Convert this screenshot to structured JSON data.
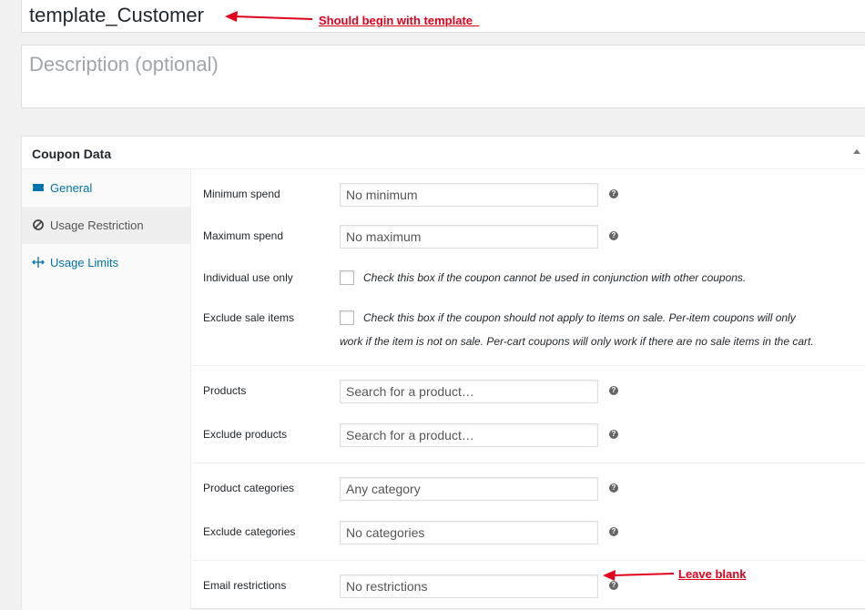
{
  "post": {
    "title": "template_Customer",
    "description_placeholder": "Description (optional)"
  },
  "annotations": {
    "title_note": "Should begin with template_",
    "email_note": "Leave blank"
  },
  "coupon_data": {
    "title": "Coupon Data",
    "tabs": [
      {
        "label": "General",
        "icon": "ticket-icon"
      },
      {
        "label": "Usage Restriction",
        "icon": "no-entry-icon"
      },
      {
        "label": "Usage Limits",
        "icon": "move-icon"
      }
    ],
    "fields": {
      "minimum_spend": {
        "label": "Minimum spend",
        "placeholder": "No minimum"
      },
      "maximum_spend": {
        "label": "Maximum spend",
        "placeholder": "No maximum"
      },
      "individual_use": {
        "label": "Individual use only",
        "description": "Check this box if the coupon cannot be used in conjunction with other coupons."
      },
      "exclude_sale": {
        "label": "Exclude sale items",
        "description_line1": "Check this box if the coupon should not apply to items on sale. Per-item coupons will only",
        "description_line2": "work if the item is not on sale. Per-cart coupons will only work if there are no sale items in the cart."
      },
      "products": {
        "label": "Products",
        "placeholder": "Search for a product…"
      },
      "exclude_products": {
        "label": "Exclude products",
        "placeholder": "Search for a product…"
      },
      "product_categories": {
        "label": "Product categories",
        "placeholder": "Any category"
      },
      "exclude_categories": {
        "label": "Exclude categories",
        "placeholder": "No categories"
      },
      "email_restrictions": {
        "label": "Email restrictions",
        "placeholder": "No restrictions"
      }
    }
  },
  "colors": {
    "link": "#0073aa",
    "annotation": "#e0001b",
    "help_icon": "#666666"
  }
}
